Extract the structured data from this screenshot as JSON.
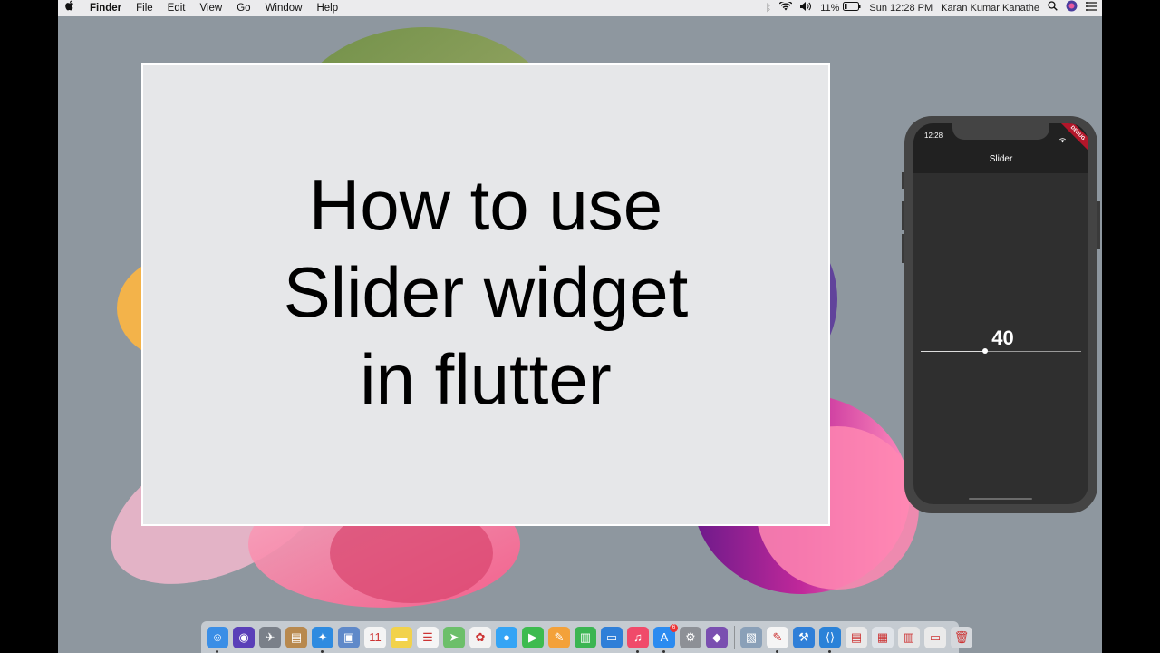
{
  "menubar": {
    "app_name": "Finder",
    "items": [
      "File",
      "Edit",
      "View",
      "Go",
      "Window",
      "Help"
    ],
    "battery": "11%",
    "clock": "Sun 12:28 PM",
    "user": "Karan Kumar Kanathe",
    "icons": [
      "apple-icon",
      "bluetooth-icon",
      "wifi-icon",
      "volume-icon",
      "battery-icon",
      "spotlight-icon",
      "siri-icon",
      "notification-center-icon"
    ]
  },
  "title_card": {
    "line1": "How to use",
    "line2": "Slider widget",
    "line3": "in flutter"
  },
  "phone": {
    "status_time": "12:28",
    "debug_banner": "DEBUG",
    "app_title": "Slider",
    "slider_value": "40",
    "slider_fraction": 0.4
  },
  "dock": {
    "apps": [
      {
        "name": "finder-icon",
        "glyph": "☺",
        "color": "#3a8ee6",
        "running": true
      },
      {
        "name": "siri-icon",
        "glyph": "◉",
        "color": "#5a3fb8",
        "running": false
      },
      {
        "name": "launchpad-icon",
        "glyph": "✈",
        "color": "#7a8089",
        "running": false
      },
      {
        "name": "contacts-icon",
        "glyph": "▤",
        "color": "#b8894e",
        "running": false
      },
      {
        "name": "safari-icon",
        "glyph": "✦",
        "color": "#2e8be0",
        "running": true
      },
      {
        "name": "preview-icon",
        "glyph": "▣",
        "color": "#5f89c9",
        "running": false
      },
      {
        "name": "calendar-icon",
        "glyph": "11",
        "color": "#f4f4f4",
        "running": false
      },
      {
        "name": "notes-icon",
        "glyph": "▬",
        "color": "#f2d24b",
        "running": false
      },
      {
        "name": "reminders-icon",
        "glyph": "☰",
        "color": "#f5f5f5",
        "running": false
      },
      {
        "name": "maps-icon",
        "glyph": "➤",
        "color": "#6cbf6a",
        "running": false
      },
      {
        "name": "photos-icon",
        "glyph": "✿",
        "color": "#f3f3f3",
        "running": false
      },
      {
        "name": "messages-icon",
        "glyph": "●",
        "color": "#34a4f5",
        "running": false
      },
      {
        "name": "facetime-icon",
        "glyph": "▶",
        "color": "#3dbb4f",
        "running": false
      },
      {
        "name": "pages-icon",
        "glyph": "✎",
        "color": "#f3a13a",
        "running": false
      },
      {
        "name": "numbers-icon",
        "glyph": "▥",
        "color": "#3bb552",
        "running": false
      },
      {
        "name": "keynote-icon",
        "glyph": "▭",
        "color": "#2f7fd8",
        "running": false
      },
      {
        "name": "music-icon",
        "glyph": "♫",
        "color": "#f04a6a",
        "running": true
      },
      {
        "name": "app-store-icon",
        "glyph": "A",
        "color": "#2b8bf0",
        "running": true,
        "badge": "6"
      },
      {
        "name": "system-preferences-icon",
        "glyph": "⚙",
        "color": "#8d9096",
        "running": false
      },
      {
        "name": "github-icon",
        "glyph": "◆",
        "color": "#7a4fb0",
        "running": false
      }
    ],
    "others": [
      {
        "name": "screenshot-thumbnail-icon",
        "glyph": "▧",
        "color": "#8aa0b8",
        "running": false
      },
      {
        "name": "textedit-icon",
        "glyph": "✎",
        "color": "#f5f5f5",
        "running": true
      },
      {
        "name": "xcode-icon",
        "glyph": "⚒",
        "color": "#2f7fd8",
        "running": false
      },
      {
        "name": "vs-code-icon",
        "glyph": "⟨⟩",
        "color": "#2a82d8",
        "running": true
      },
      {
        "name": "document-stack-icon",
        "glyph": "▤",
        "color": "#e9e9e9",
        "running": false
      },
      {
        "name": "screenshot-stack-icon",
        "glyph": "▦",
        "color": "#dfe3e8",
        "running": false
      },
      {
        "name": "downloads-stack-icon",
        "glyph": "▥",
        "color": "#e6e6e6",
        "running": false
      },
      {
        "name": "folder-stack-icon",
        "glyph": "▭",
        "color": "#eaeaea",
        "running": false
      },
      {
        "name": "trash-icon",
        "glyph": "🗑",
        "color": "#d5d8dc",
        "running": false
      }
    ]
  }
}
